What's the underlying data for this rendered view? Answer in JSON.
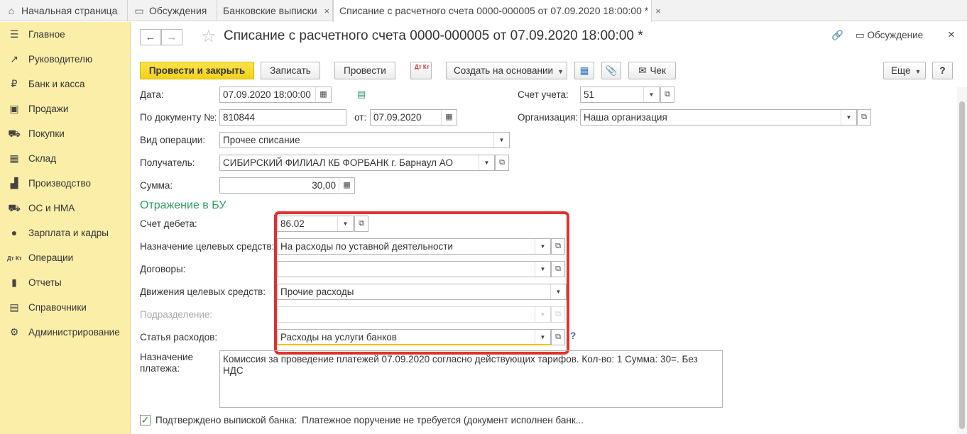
{
  "tabs": [
    {
      "label": "Начальная страница",
      "icon": "home-icon",
      "glyph": "⌂"
    },
    {
      "label": "Обсуждения",
      "icon": "chat-icon",
      "glyph": "▭"
    },
    {
      "label": "Банковские выписки",
      "close": "×"
    },
    {
      "label": "Списание с расчетного счета 0000-000005 от 07.09.2020 18:00:00 *",
      "close": "×",
      "active": true
    }
  ],
  "sidebar": {
    "items": [
      {
        "label": "Главное",
        "icon": "menu-icon",
        "glyph": "☰"
      },
      {
        "label": "Руководителю",
        "icon": "trend-icon",
        "glyph": "↗"
      },
      {
        "label": "Банк и касса",
        "icon": "ruble-icon",
        "glyph": "₽"
      },
      {
        "label": "Продажи",
        "icon": "bag-icon",
        "glyph": "▣"
      },
      {
        "label": "Покупки",
        "icon": "cart-icon",
        "glyph": "⛟"
      },
      {
        "label": "Склад",
        "icon": "warehouse-icon",
        "glyph": "▦"
      },
      {
        "label": "Производство",
        "icon": "factory-icon",
        "glyph": "▟"
      },
      {
        "label": "ОС и НМА",
        "icon": "truck-icon",
        "glyph": "⛟"
      },
      {
        "label": "Зарплата и кадры",
        "icon": "person-icon",
        "glyph": "●"
      },
      {
        "label": "Операции",
        "icon": "dt-kt-icon",
        "glyph": "Дт Кт"
      },
      {
        "label": "Отчеты",
        "icon": "bar-chart-icon",
        "glyph": "▮"
      },
      {
        "label": "Справочники",
        "icon": "book-icon",
        "glyph": "▤"
      },
      {
        "label": "Администрирование",
        "icon": "gear-icon",
        "glyph": "⚙"
      }
    ]
  },
  "header": {
    "back": "←",
    "forward": "→",
    "star": "☆",
    "title": "Списание с расчетного счета 0000-000005 от 07.09.2020 18:00:00 *",
    "link_glyph": "🔗",
    "discuss_label": "Обсуждение",
    "discuss_glyph": "▭",
    "close": "×"
  },
  "toolbar": {
    "post_close": "Провести и закрыть",
    "save": "Записать",
    "post": "Провести",
    "dtkt": "Дт Кт",
    "create_based": "Создать на основании",
    "struct_glyph": "▦",
    "attach_glyph": "📎",
    "receipt": "Чек",
    "receipt_glyph": "✉",
    "more": "Еще",
    "help": "?"
  },
  "form": {
    "date_label": "Дата:",
    "date_value": "07.09.2020 18:00:00",
    "doc_label": "По документу №:",
    "doc_value": "810844",
    "from_label": "от:",
    "from_value": "07.09.2020",
    "optype_label": "Вид операции:",
    "optype_value": "Прочее списание",
    "recipient_label": "Получатель:",
    "recipient_value": "СИБИРСКИЙ ФИЛИАЛ КБ ФОРБАНК г. Барнаул АО",
    "sum_label": "Сумма:",
    "sum_value": "30,00",
    "account_label": "Счет учета:",
    "account_value": "51",
    "org_label": "Организация:",
    "org_value": "Наша организация"
  },
  "bu": {
    "section_title": "Отражение в БУ",
    "debit_label": "Счет дебета:",
    "debit_value": "86.02",
    "purpose_funds_label": "Назначение целевых средств:",
    "purpose_funds_value": "На расходы по уставной деятельности",
    "contracts_label": "Договоры:",
    "contracts_value": "",
    "movements_label": "Движения целевых средств:",
    "movements_value": "Прочие расходы",
    "division_label": "Подразделение:",
    "division_value": "",
    "expense_label": "Статья расходов:",
    "expense_value": "Расходы на услуги банков",
    "help": "?"
  },
  "payment": {
    "label_line1": "Назначение",
    "label_line2": "платежа:",
    "text": "Комиссия за проведение платежей 07.09.2020 согласно действующих тарифов.  Кол-во: 1 Сумма: 30=. Без НДС"
  },
  "footer": {
    "confirmed_label": "Подтверждено выпиской банка:",
    "confirmed_checked": true,
    "check_glyph": "✓",
    "order_note": "Платежное поручение не требуется (документ исполнен банк..."
  },
  "colors": {
    "sidebar_bg": "#fbeea8",
    "primary_btn": "#f2d11a",
    "section_green": "#2e9b62",
    "highlight_red": "#e0312d"
  }
}
